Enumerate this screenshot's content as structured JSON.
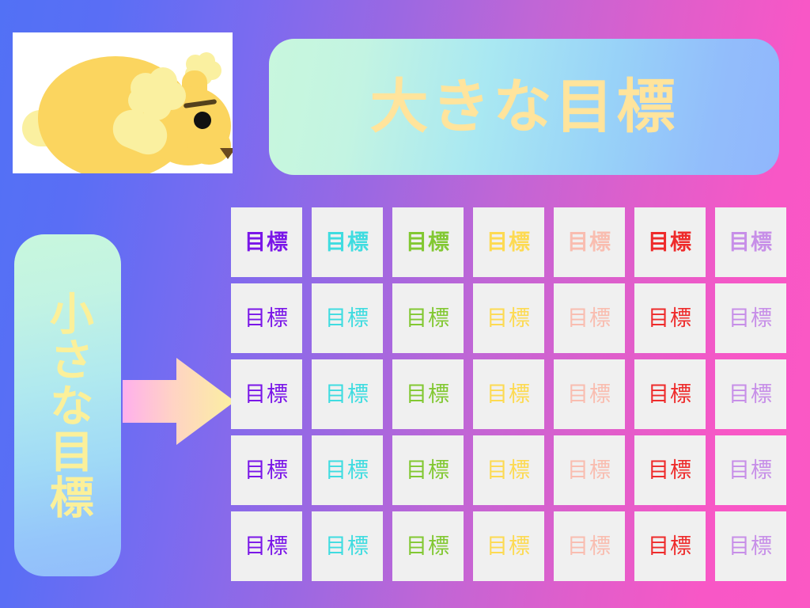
{
  "background": {
    "gradient_from": "#5271F5",
    "gradient_mid": "#A766DF",
    "gradient_to": "#FB58C4"
  },
  "illustration": {
    "name": "sleeping-yellow-poodle",
    "alt": "yellow poodle dog lying down",
    "body_color": "#FBD55F",
    "fluff_color": "#FAF0A0",
    "eye_color": "#111111",
    "nose_color": "#6B4A1E",
    "frame_color": "#FFFFFF"
  },
  "banner": {
    "title": "大きな目標",
    "text_color": "#FFE49C",
    "gradient_from": "#C8F7DD",
    "gradient_to": "#90B6FC"
  },
  "side_panel": {
    "title": "小さな目標",
    "text_color": "#FBF09A",
    "gradient_from": "#C8F7DD",
    "gradient_to": "#92BDFB"
  },
  "arrow": {
    "name": "right-arrow",
    "gradient_from": "#FFB0EC",
    "gradient_to": "#FBF0A0"
  },
  "grid": {
    "rows": 5,
    "columns": 7,
    "card_background": "#F0F0F0",
    "column_colors": [
      "#7A16E8",
      "#3FDCE0",
      "#82C832",
      "#FDDA52",
      "#F9BDB0",
      "#EE2B2B",
      "#C78FE8"
    ],
    "row_weights": [
      "bold",
      "normal",
      "normal",
      "normal",
      "normal"
    ],
    "cells": [
      [
        "目標",
        "目標",
        "目標",
        "目標",
        "目標",
        "目標",
        "目標"
      ],
      [
        "目標",
        "目標",
        "目標",
        "目標",
        "目標",
        "目標",
        "目標"
      ],
      [
        "目標",
        "目標",
        "目標",
        "目標",
        "目標",
        "目標",
        "目標"
      ],
      [
        "目標",
        "目標",
        "目標",
        "目標",
        "目標",
        "目標",
        "目標"
      ],
      [
        "目標",
        "目標",
        "目標",
        "目標",
        "目標",
        "目標",
        "目標"
      ]
    ]
  }
}
